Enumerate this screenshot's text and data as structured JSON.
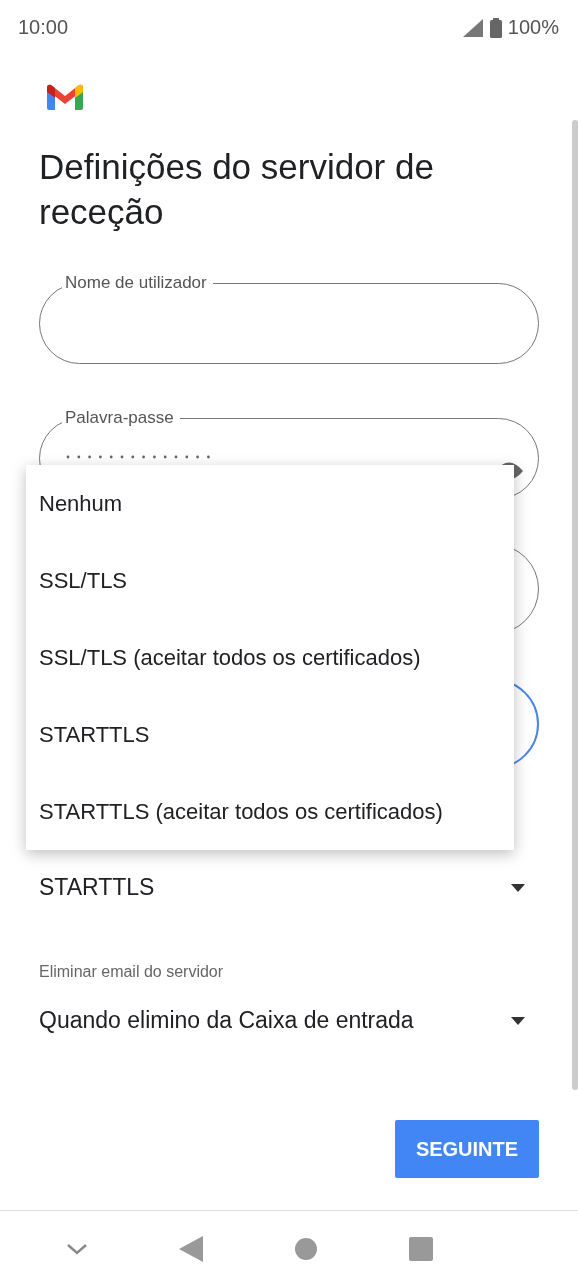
{
  "status_bar": {
    "time": "10:00",
    "battery": "100%"
  },
  "title": "Definições do servidor de receção",
  "fields": [
    {
      "label": "Nome de utilizador",
      "masked": false,
      "focused": false
    },
    {
      "label": "Palavra-passe",
      "masked": true,
      "focused": false
    },
    {
      "focused": false
    },
    {
      "focused": true
    }
  ],
  "security": {
    "value": "STARTTLS"
  },
  "delete_setting": {
    "label": "Eliminar email do servidor",
    "value": "Quando elimino da Caixa de entrada"
  },
  "next_button": "SEGUINTE",
  "menu": {
    "items": [
      "Nenhum",
      "SSL/TLS",
      "SSL/TLS (aceitar todos os certificados)",
      "STARTTLS",
      "STARTTLS (aceitar todos os certificados)"
    ]
  }
}
